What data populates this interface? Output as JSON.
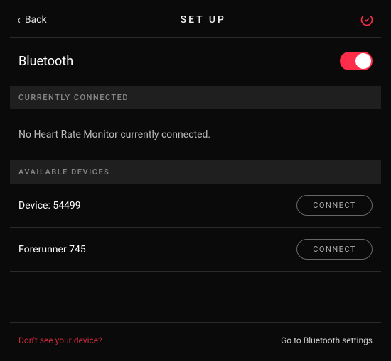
{
  "header": {
    "back_label": "Back",
    "title": "SET UP"
  },
  "bluetooth": {
    "label": "Bluetooth",
    "enabled": true
  },
  "sections": {
    "connected_header": "CURRENTLY CONNECTED",
    "connected_empty": "No Heart Rate Monitor currently connected.",
    "available_header": "AVAILABLE DEVICES"
  },
  "devices": [
    {
      "name": "Device: 54499",
      "action": "CONNECT"
    },
    {
      "name": "Forerunner 745",
      "action": "CONNECT"
    }
  ],
  "footer": {
    "help_text": "Don't see your device?",
    "settings_link": "Go to Bluetooth settings"
  }
}
